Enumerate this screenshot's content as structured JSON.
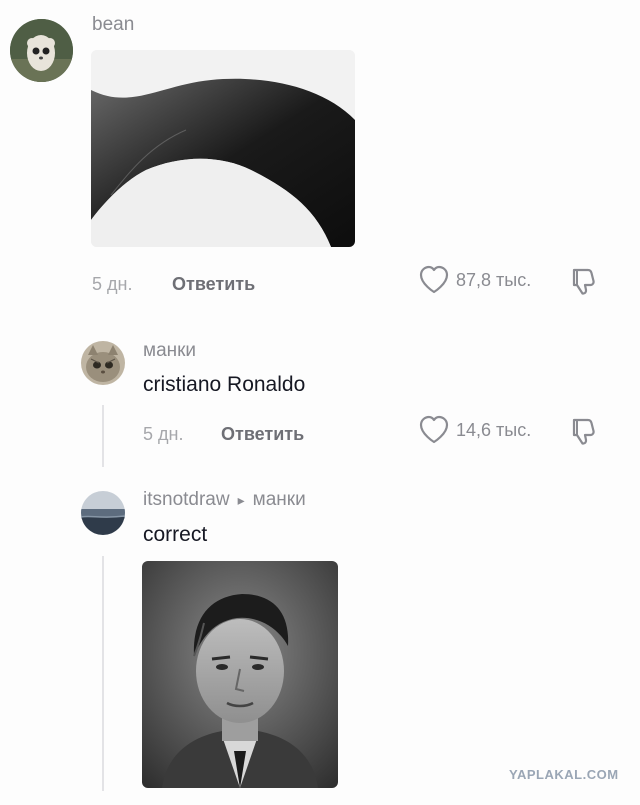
{
  "comments": [
    {
      "username": "bean",
      "time": "5 дн.",
      "reply_label": "Ответить",
      "likes": "87,8 тыс."
    },
    {
      "username": "манки",
      "text": "cristiano Ronaldo",
      "time": "5 дн.",
      "reply_label": "Ответить",
      "likes": "14,6 тыс."
    },
    {
      "username": "itsnotdraw",
      "reply_to_arrow": "▸",
      "reply_to": "манки",
      "text": "correct"
    }
  ],
  "watermark": "YAPLAKAL.COM",
  "icons": [
    "heart-icon",
    "dislike-icon",
    "reply-arrow-icon"
  ]
}
